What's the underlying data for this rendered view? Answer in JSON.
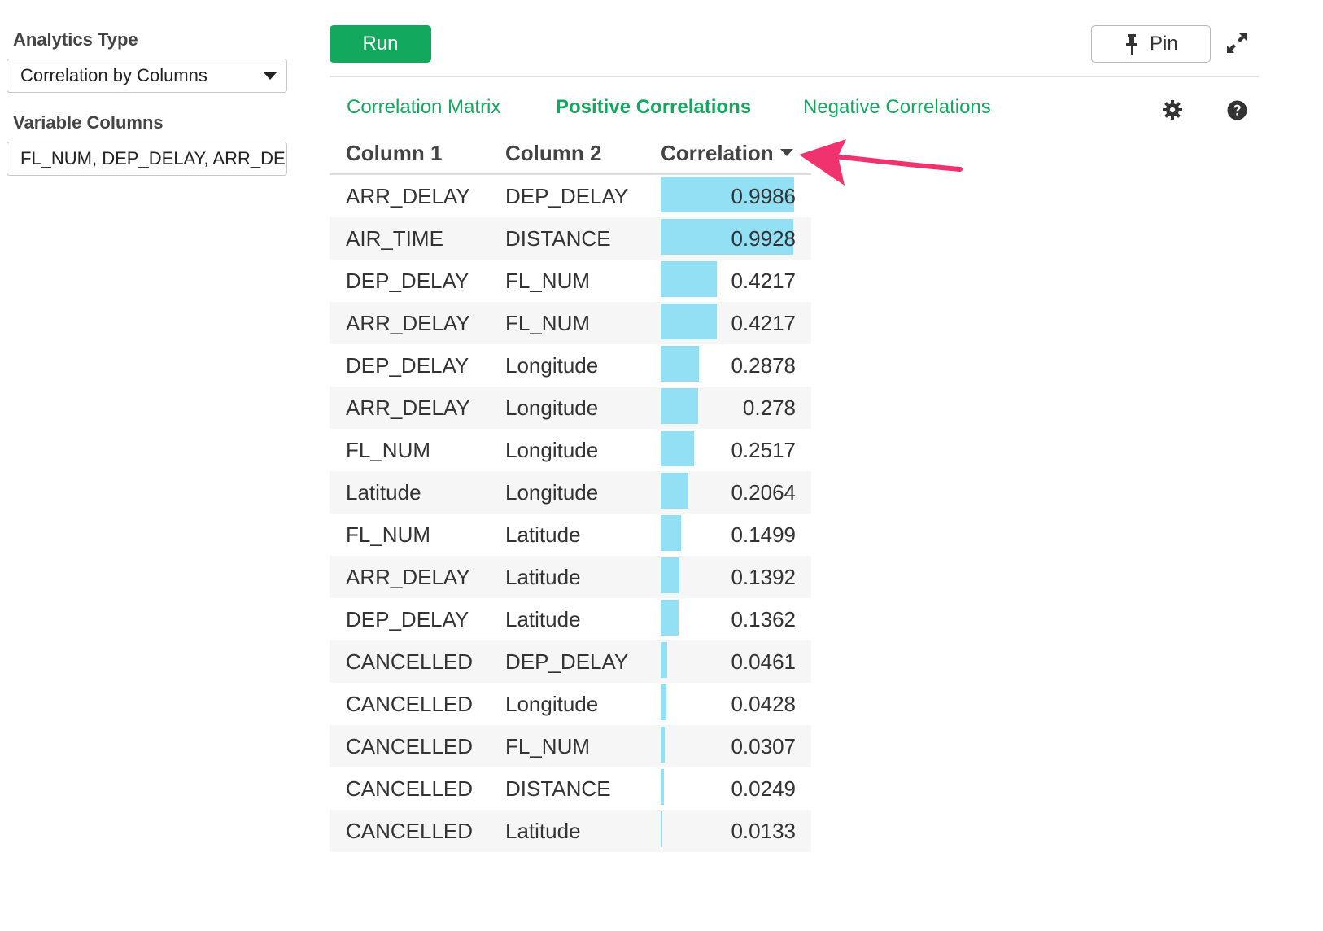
{
  "sidebar": {
    "analytics_type_label": "Analytics Type",
    "analytics_type_value": "Correlation by Columns",
    "variable_columns_label": "Variable Columns",
    "variable_columns_value": "FL_NUM, DEP_DELAY, ARR_DELAY"
  },
  "toolbar": {
    "run_label": "Run",
    "pin_label": "Pin",
    "pin_icon": "pin-icon",
    "expand_icon": "expand-icon"
  },
  "tabs": [
    {
      "label": "Correlation Matrix",
      "active": false
    },
    {
      "label": "Positive Correlations",
      "active": true
    },
    {
      "label": "Negative Correlations",
      "active": false
    }
  ],
  "icons": {
    "settings": "gear-icon",
    "help": "help-icon"
  },
  "colors": {
    "accent": "#12a95f",
    "bar": "#93e0f4",
    "annotation_arrow": "#f0336e"
  },
  "table": {
    "headers": {
      "column1": "Column 1",
      "column2": "Column 2",
      "correlation": "Correlation"
    },
    "sort": "descending",
    "rows": [
      {
        "c1": "ARR_DELAY",
        "c2": "DEP_DELAY",
        "corr": "0.9986",
        "value": 0.9986
      },
      {
        "c1": "AIR_TIME",
        "c2": "DISTANCE",
        "corr": "0.9928",
        "value": 0.9928
      },
      {
        "c1": "DEP_DELAY",
        "c2": "FL_NUM",
        "corr": "0.4217",
        "value": 0.4217
      },
      {
        "c1": "ARR_DELAY",
        "c2": "FL_NUM",
        "corr": "0.4217",
        "value": 0.4217
      },
      {
        "c1": "DEP_DELAY",
        "c2": "Longitude",
        "corr": "0.2878",
        "value": 0.2878
      },
      {
        "c1": "ARR_DELAY",
        "c2": "Longitude",
        "corr": "0.278",
        "value": 0.278
      },
      {
        "c1": "FL_NUM",
        "c2": "Longitude",
        "corr": "0.2517",
        "value": 0.2517
      },
      {
        "c1": "Latitude",
        "c2": "Longitude",
        "corr": "0.2064",
        "value": 0.2064
      },
      {
        "c1": "FL_NUM",
        "c2": "Latitude",
        "corr": "0.1499",
        "value": 0.1499
      },
      {
        "c1": "ARR_DELAY",
        "c2": "Latitude",
        "corr": "0.1392",
        "value": 0.1392
      },
      {
        "c1": "DEP_DELAY",
        "c2": "Latitude",
        "corr": "0.1362",
        "value": 0.1362
      },
      {
        "c1": "CANCELLED",
        "c2": "DEP_DELAY",
        "corr": "0.0461",
        "value": 0.0461
      },
      {
        "c1": "CANCELLED",
        "c2": "Longitude",
        "corr": "0.0428",
        "value": 0.0428
      },
      {
        "c1": "CANCELLED",
        "c2": "FL_NUM",
        "corr": "0.0307",
        "value": 0.0307
      },
      {
        "c1": "CANCELLED",
        "c2": "DISTANCE",
        "corr": "0.0249",
        "value": 0.0249
      },
      {
        "c1": "CANCELLED",
        "c2": "Latitude",
        "corr": "0.0133",
        "value": 0.0133
      }
    ]
  }
}
